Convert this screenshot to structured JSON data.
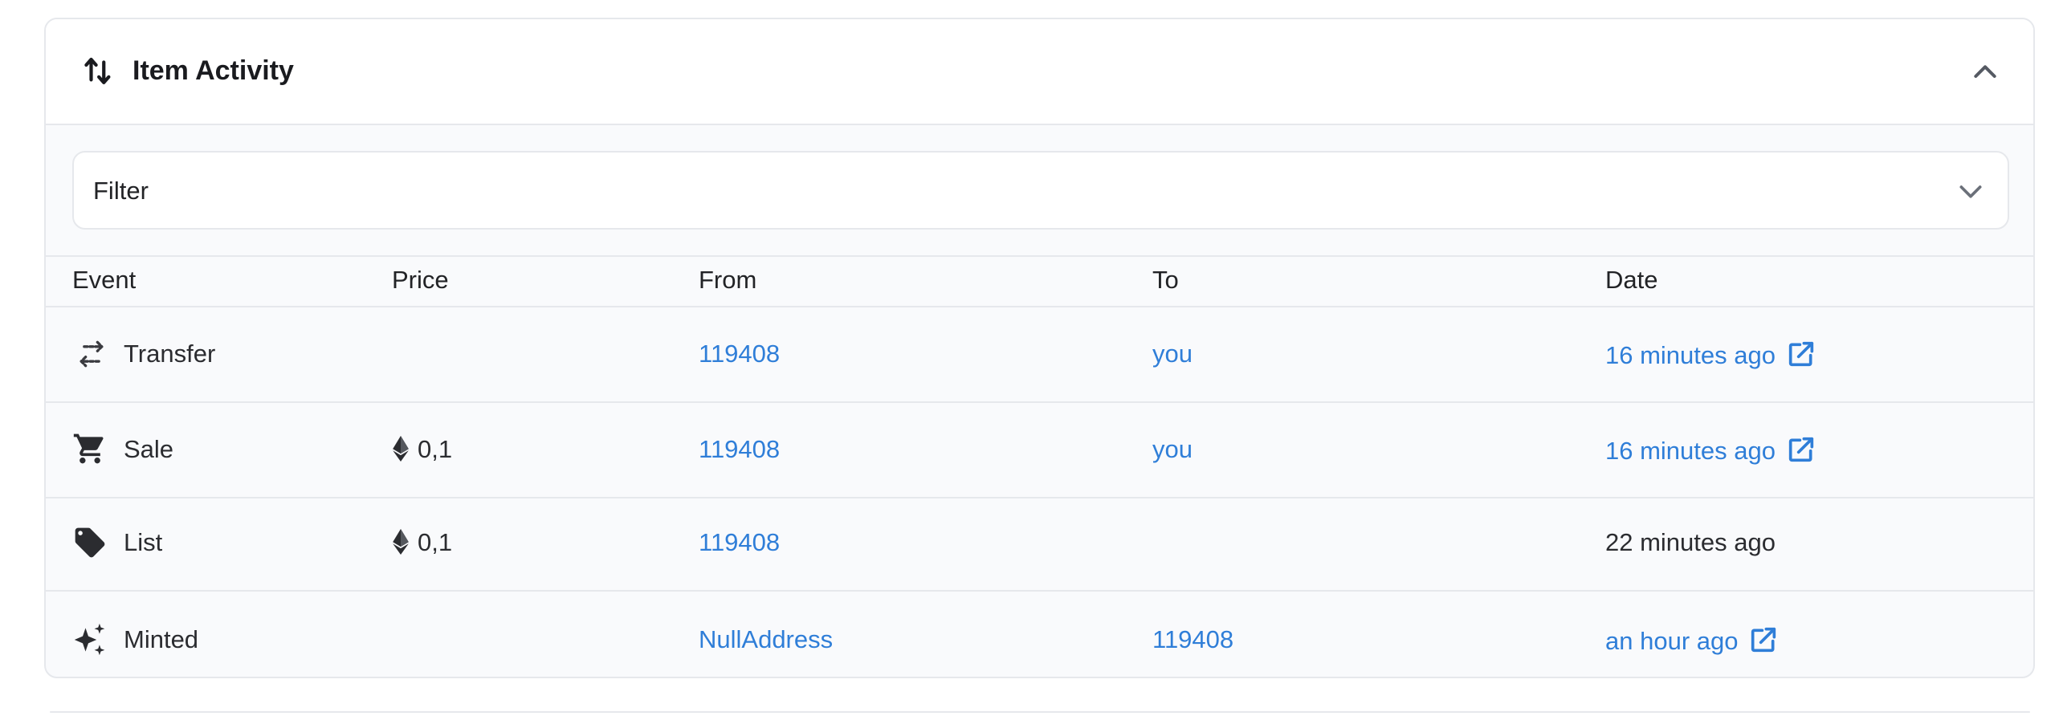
{
  "panel": {
    "title": "Item Activity",
    "header_icon": "swap-vertical-icon",
    "collapse_icon": "chevron-up-icon"
  },
  "filter": {
    "label": "Filter",
    "icon": "chevron-down-icon"
  },
  "table": {
    "columns": [
      "Event",
      "Price",
      "From",
      "To",
      "Date"
    ],
    "rows": [
      {
        "event": "Transfer",
        "icon": "transfer-icon",
        "price": "",
        "from": "119408",
        "to": "you",
        "date": "16 minutes ago",
        "date_link": true
      },
      {
        "event": "Sale",
        "icon": "cart-icon",
        "price": "0,1",
        "from": "119408",
        "to": "you",
        "date": "16 minutes ago",
        "date_link": true
      },
      {
        "event": "List",
        "icon": "tag-icon",
        "price": "0,1",
        "from": "119408",
        "to": "",
        "date": "22 minutes ago",
        "date_link": false
      },
      {
        "event": "Minted",
        "icon": "sparkles-icon",
        "price": "",
        "from": "NullAddress",
        "to": "119408",
        "date": "an hour ago",
        "date_link": true
      }
    ]
  },
  "colors": {
    "link": "#2f7ed8",
    "border": "#e6e8ec",
    "row_background": "#f9fafc"
  }
}
